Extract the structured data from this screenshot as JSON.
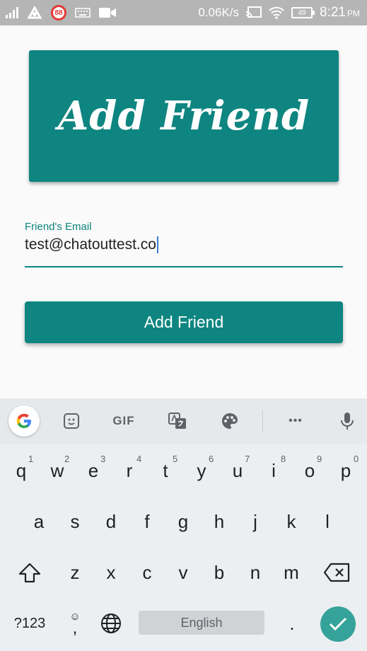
{
  "status_bar": {
    "badge_count": "88",
    "net_speed": "0.06K/s",
    "battery_level": "49",
    "time": "8:21",
    "ampm": "PM"
  },
  "hero": {
    "title": "Add Friend"
  },
  "form": {
    "email_label": "Friend's Email",
    "email_value": "test@chatouttest.co"
  },
  "add_button": {
    "label": "Add Friend"
  },
  "keyboard": {
    "gif_label": "GIF",
    "more_label": "•••",
    "row1": [
      {
        "key": "q",
        "hint": "1"
      },
      {
        "key": "w",
        "hint": "2"
      },
      {
        "key": "e",
        "hint": "3"
      },
      {
        "key": "r",
        "hint": "4"
      },
      {
        "key": "t",
        "hint": "5"
      },
      {
        "key": "y",
        "hint": "6"
      },
      {
        "key": "u",
        "hint": "7"
      },
      {
        "key": "i",
        "hint": "8"
      },
      {
        "key": "o",
        "hint": "9"
      },
      {
        "key": "p",
        "hint": "0"
      }
    ],
    "row2": [
      "a",
      "s",
      "d",
      "f",
      "g",
      "h",
      "j",
      "k",
      "l"
    ],
    "row3": [
      "z",
      "x",
      "c",
      "v",
      "b",
      "n",
      "m"
    ],
    "symbols_label": "?123",
    "comma_label": ",",
    "space_label": "English",
    "period_label": "."
  }
}
